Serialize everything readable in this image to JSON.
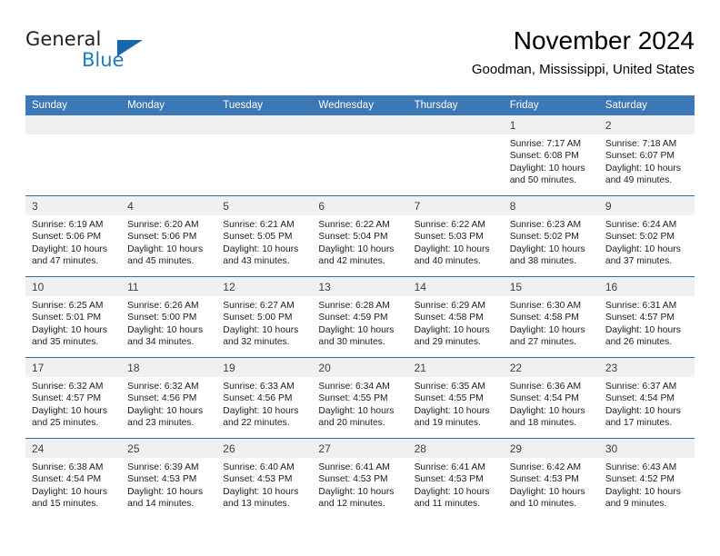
{
  "brand": {
    "name_part1": "General",
    "name_part2": "Blue",
    "accent_color": "#1c7ac0",
    "triangle_color": "#1667b0"
  },
  "header": {
    "title": "November 2024",
    "location": "Goodman, Mississippi, United States"
  },
  "colors": {
    "header_blue": "#3b78b5",
    "row_rule": "#2e6da4",
    "daynum_bg": "#f0f0f0"
  },
  "weekday_headers": [
    "Sunday",
    "Monday",
    "Tuesday",
    "Wednesday",
    "Thursday",
    "Friday",
    "Saturday"
  ],
  "weeks": [
    [
      {
        "day": "",
        "blank": true,
        "sunrise": "",
        "sunset": "",
        "daylight1": "",
        "daylight2": ""
      },
      {
        "day": "",
        "blank": true,
        "sunrise": "",
        "sunset": "",
        "daylight1": "",
        "daylight2": ""
      },
      {
        "day": "",
        "blank": true,
        "sunrise": "",
        "sunset": "",
        "daylight1": "",
        "daylight2": ""
      },
      {
        "day": "",
        "blank": true,
        "sunrise": "",
        "sunset": "",
        "daylight1": "",
        "daylight2": ""
      },
      {
        "day": "",
        "blank": true,
        "sunrise": "",
        "sunset": "",
        "daylight1": "",
        "daylight2": ""
      },
      {
        "day": "1",
        "blank": false,
        "sunrise": "Sunrise: 7:17 AM",
        "sunset": "Sunset: 6:08 PM",
        "daylight1": "Daylight: 10 hours",
        "daylight2": "and 50 minutes."
      },
      {
        "day": "2",
        "blank": false,
        "sunrise": "Sunrise: 7:18 AM",
        "sunset": "Sunset: 6:07 PM",
        "daylight1": "Daylight: 10 hours",
        "daylight2": "and 49 minutes."
      }
    ],
    [
      {
        "day": "3",
        "blank": false,
        "sunrise": "Sunrise: 6:19 AM",
        "sunset": "Sunset: 5:06 PM",
        "daylight1": "Daylight: 10 hours",
        "daylight2": "and 47 minutes."
      },
      {
        "day": "4",
        "blank": false,
        "sunrise": "Sunrise: 6:20 AM",
        "sunset": "Sunset: 5:06 PM",
        "daylight1": "Daylight: 10 hours",
        "daylight2": "and 45 minutes."
      },
      {
        "day": "5",
        "blank": false,
        "sunrise": "Sunrise: 6:21 AM",
        "sunset": "Sunset: 5:05 PM",
        "daylight1": "Daylight: 10 hours",
        "daylight2": "and 43 minutes."
      },
      {
        "day": "6",
        "blank": false,
        "sunrise": "Sunrise: 6:22 AM",
        "sunset": "Sunset: 5:04 PM",
        "daylight1": "Daylight: 10 hours",
        "daylight2": "and 42 minutes."
      },
      {
        "day": "7",
        "blank": false,
        "sunrise": "Sunrise: 6:22 AM",
        "sunset": "Sunset: 5:03 PM",
        "daylight1": "Daylight: 10 hours",
        "daylight2": "and 40 minutes."
      },
      {
        "day": "8",
        "blank": false,
        "sunrise": "Sunrise: 6:23 AM",
        "sunset": "Sunset: 5:02 PM",
        "daylight1": "Daylight: 10 hours",
        "daylight2": "and 38 minutes."
      },
      {
        "day": "9",
        "blank": false,
        "sunrise": "Sunrise: 6:24 AM",
        "sunset": "Sunset: 5:02 PM",
        "daylight1": "Daylight: 10 hours",
        "daylight2": "and 37 minutes."
      }
    ],
    [
      {
        "day": "10",
        "blank": false,
        "sunrise": "Sunrise: 6:25 AM",
        "sunset": "Sunset: 5:01 PM",
        "daylight1": "Daylight: 10 hours",
        "daylight2": "and 35 minutes."
      },
      {
        "day": "11",
        "blank": false,
        "sunrise": "Sunrise: 6:26 AM",
        "sunset": "Sunset: 5:00 PM",
        "daylight1": "Daylight: 10 hours",
        "daylight2": "and 34 minutes."
      },
      {
        "day": "12",
        "blank": false,
        "sunrise": "Sunrise: 6:27 AM",
        "sunset": "Sunset: 5:00 PM",
        "daylight1": "Daylight: 10 hours",
        "daylight2": "and 32 minutes."
      },
      {
        "day": "13",
        "blank": false,
        "sunrise": "Sunrise: 6:28 AM",
        "sunset": "Sunset: 4:59 PM",
        "daylight1": "Daylight: 10 hours",
        "daylight2": "and 30 minutes."
      },
      {
        "day": "14",
        "blank": false,
        "sunrise": "Sunrise: 6:29 AM",
        "sunset": "Sunset: 4:58 PM",
        "daylight1": "Daylight: 10 hours",
        "daylight2": "and 29 minutes."
      },
      {
        "day": "15",
        "blank": false,
        "sunrise": "Sunrise: 6:30 AM",
        "sunset": "Sunset: 4:58 PM",
        "daylight1": "Daylight: 10 hours",
        "daylight2": "and 27 minutes."
      },
      {
        "day": "16",
        "blank": false,
        "sunrise": "Sunrise: 6:31 AM",
        "sunset": "Sunset: 4:57 PM",
        "daylight1": "Daylight: 10 hours",
        "daylight2": "and 26 minutes."
      }
    ],
    [
      {
        "day": "17",
        "blank": false,
        "sunrise": "Sunrise: 6:32 AM",
        "sunset": "Sunset: 4:57 PM",
        "daylight1": "Daylight: 10 hours",
        "daylight2": "and 25 minutes."
      },
      {
        "day": "18",
        "blank": false,
        "sunrise": "Sunrise: 6:32 AM",
        "sunset": "Sunset: 4:56 PM",
        "daylight1": "Daylight: 10 hours",
        "daylight2": "and 23 minutes."
      },
      {
        "day": "19",
        "blank": false,
        "sunrise": "Sunrise: 6:33 AM",
        "sunset": "Sunset: 4:56 PM",
        "daylight1": "Daylight: 10 hours",
        "daylight2": "and 22 minutes."
      },
      {
        "day": "20",
        "blank": false,
        "sunrise": "Sunrise: 6:34 AM",
        "sunset": "Sunset: 4:55 PM",
        "daylight1": "Daylight: 10 hours",
        "daylight2": "and 20 minutes."
      },
      {
        "day": "21",
        "blank": false,
        "sunrise": "Sunrise: 6:35 AM",
        "sunset": "Sunset: 4:55 PM",
        "daylight1": "Daylight: 10 hours",
        "daylight2": "and 19 minutes."
      },
      {
        "day": "22",
        "blank": false,
        "sunrise": "Sunrise: 6:36 AM",
        "sunset": "Sunset: 4:54 PM",
        "daylight1": "Daylight: 10 hours",
        "daylight2": "and 18 minutes."
      },
      {
        "day": "23",
        "blank": false,
        "sunrise": "Sunrise: 6:37 AM",
        "sunset": "Sunset: 4:54 PM",
        "daylight1": "Daylight: 10 hours",
        "daylight2": "and 17 minutes."
      }
    ],
    [
      {
        "day": "24",
        "blank": false,
        "sunrise": "Sunrise: 6:38 AM",
        "sunset": "Sunset: 4:54 PM",
        "daylight1": "Daylight: 10 hours",
        "daylight2": "and 15 minutes."
      },
      {
        "day": "25",
        "blank": false,
        "sunrise": "Sunrise: 6:39 AM",
        "sunset": "Sunset: 4:53 PM",
        "daylight1": "Daylight: 10 hours",
        "daylight2": "and 14 minutes."
      },
      {
        "day": "26",
        "blank": false,
        "sunrise": "Sunrise: 6:40 AM",
        "sunset": "Sunset: 4:53 PM",
        "daylight1": "Daylight: 10 hours",
        "daylight2": "and 13 minutes."
      },
      {
        "day": "27",
        "blank": false,
        "sunrise": "Sunrise: 6:41 AM",
        "sunset": "Sunset: 4:53 PM",
        "daylight1": "Daylight: 10 hours",
        "daylight2": "and 12 minutes."
      },
      {
        "day": "28",
        "blank": false,
        "sunrise": "Sunrise: 6:41 AM",
        "sunset": "Sunset: 4:53 PM",
        "daylight1": "Daylight: 10 hours",
        "daylight2": "and 11 minutes."
      },
      {
        "day": "29",
        "blank": false,
        "sunrise": "Sunrise: 6:42 AM",
        "sunset": "Sunset: 4:53 PM",
        "daylight1": "Daylight: 10 hours",
        "daylight2": "and 10 minutes."
      },
      {
        "day": "30",
        "blank": false,
        "sunrise": "Sunrise: 6:43 AM",
        "sunset": "Sunset: 4:52 PM",
        "daylight1": "Daylight: 10 hours",
        "daylight2": "and 9 minutes."
      }
    ]
  ]
}
